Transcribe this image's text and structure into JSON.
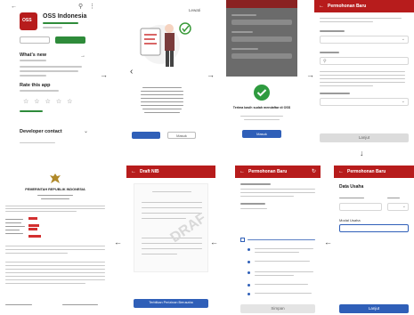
{
  "colors": {
    "brand_red": "#b71c1c",
    "brand_green": "#2e8b3a",
    "button_blue": "#2f5fb8",
    "dark_panel": "#6b6b6b",
    "line_grey": "#c9c9c9"
  },
  "playstore": {
    "app_icon_text": "OSS",
    "app_name": "OSS Indonesia",
    "whats_new": "What's new",
    "rate_this_app": "Rate this app",
    "developer_contact": "Developer contact",
    "stars": 5
  },
  "onboarding": {
    "skip_label": "Lewati",
    "secondary_button": "Masuk"
  },
  "success": {
    "title": "Terima kasih sudah mendaftar di OSS",
    "button_label": "Masuk"
  },
  "form_step1": {
    "header_title": "Permohonan Baru",
    "next_button": "Lanjut"
  },
  "draft_nib": {
    "header_title": "Draft NIB",
    "doc_title": "PEMERINTAH REPUBLIK INDONESIA",
    "stamp_text": "DRAF",
    "bottom_button": "Terbitkan Perizinan Berusaha"
  },
  "checklist": {
    "header_title": "Permohonan Baru",
    "bottom_button": "Simpan"
  },
  "data_usaha": {
    "header_title": "Permohonan Baru",
    "section_title": "Data Usaha",
    "field_label": "Modal Usaha",
    "bottom_button": "Lanjut"
  }
}
